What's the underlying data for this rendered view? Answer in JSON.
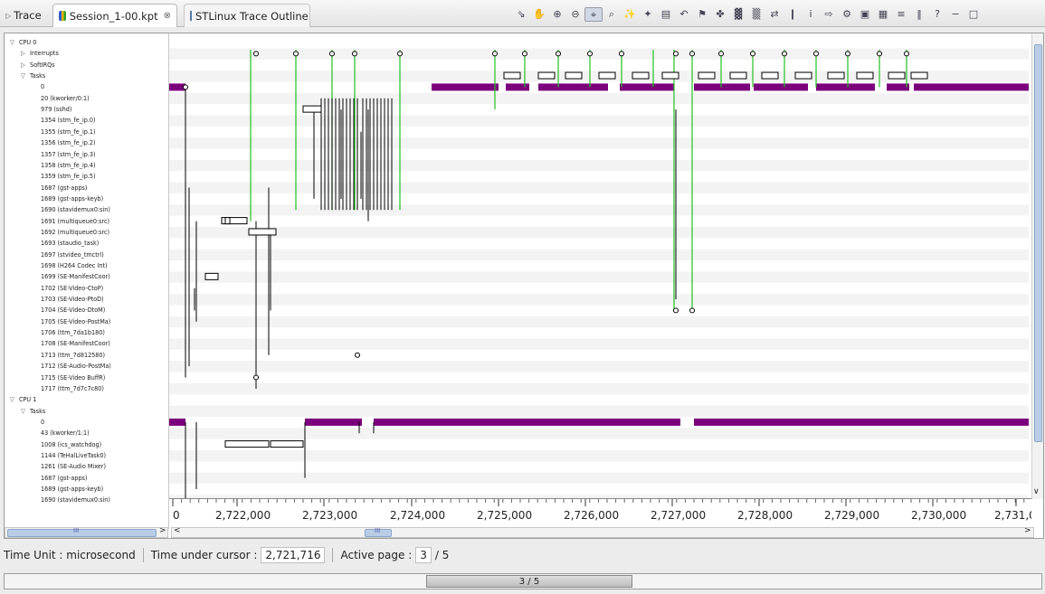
{
  "tabs": [
    {
      "label": "Trace",
      "icon": "chevron-right-icon"
    },
    {
      "label": "Session_1-00.kpt",
      "icon": "trace-file-icon",
      "close": "⊗"
    },
    {
      "label": "STLinux Trace Outline",
      "icon": "outline-icon"
    }
  ],
  "toolbar": [
    {
      "name": "select-tool-icon",
      "glyph": "⇘"
    },
    {
      "name": "hand-tool-icon",
      "glyph": "✋"
    },
    {
      "name": "zoom-in-icon",
      "glyph": "⊕"
    },
    {
      "name": "zoom-out-icon",
      "glyph": "⊖"
    },
    {
      "name": "zoom-area-icon",
      "glyph": "⌖",
      "pressed": true
    },
    {
      "name": "zoom-fit-icon",
      "glyph": "⌕"
    },
    {
      "name": "wand-icon",
      "glyph": "✨"
    },
    {
      "name": "filter-icon",
      "glyph": "✦"
    },
    {
      "name": "grid-icon",
      "glyph": "▤"
    },
    {
      "name": "undo-icon",
      "glyph": "↶"
    },
    {
      "name": "marker-icon",
      "glyph": "⚑"
    },
    {
      "name": "chart-icon",
      "glyph": "✤"
    },
    {
      "name": "histogram-icon",
      "glyph": "▓"
    },
    {
      "name": "histogram-green-icon",
      "glyph": "▒"
    },
    {
      "name": "sync-icon",
      "glyph": "⇄"
    },
    {
      "name": "bar-icon",
      "glyph": "❙"
    },
    {
      "name": "info-icon",
      "glyph": "i"
    },
    {
      "name": "export-icon",
      "glyph": "⇨"
    },
    {
      "name": "settings-icon",
      "glyph": "⚙"
    },
    {
      "name": "panel-icon",
      "glyph": "▣"
    },
    {
      "name": "layout-icon",
      "glyph": "▦"
    },
    {
      "name": "tree-icon",
      "glyph": "≡"
    },
    {
      "name": "pause-icon",
      "glyph": "‖"
    },
    {
      "name": "help-icon",
      "glyph": "?"
    },
    {
      "name": "minimize-icon",
      "glyph": "−"
    },
    {
      "name": "maximize-icon",
      "glyph": "□"
    }
  ],
  "tree_rows": [
    {
      "label": "CPU 0",
      "indent": 0,
      "twisty": "▽"
    },
    {
      "label": "Interrupts",
      "indent": 1,
      "twisty": "▷"
    },
    {
      "label": "SoftIRQs",
      "indent": 1,
      "twisty": "▷"
    },
    {
      "label": "Tasks",
      "indent": 1,
      "twisty": "▽"
    },
    {
      "label": "0",
      "indent": 2
    },
    {
      "label": "20 (kworker/0:1)",
      "indent": 2
    },
    {
      "label": "979 (sshd)",
      "indent": 2
    },
    {
      "label": "1354 (stm_fe_ip.0)",
      "indent": 2
    },
    {
      "label": "1355 (stm_fe_ip.1)",
      "indent": 2
    },
    {
      "label": "1356 (stm_fe_ip.2)",
      "indent": 2
    },
    {
      "label": "1357 (stm_fe_ip.3)",
      "indent": 2
    },
    {
      "label": "1358 (stm_fe_ip.4)",
      "indent": 2
    },
    {
      "label": "1359 (stm_fe_ip.5)",
      "indent": 2
    },
    {
      "label": "1687 (gst-apps)",
      "indent": 2
    },
    {
      "label": "1689 (gst-apps-keyb)",
      "indent": 2
    },
    {
      "label": "1690 (stavidemux0:sin)",
      "indent": 2
    },
    {
      "label": "1691 (multiqueue0:src)",
      "indent": 2
    },
    {
      "label": "1692 (multiqueue0:src)",
      "indent": 2
    },
    {
      "label": "1693 (staudio_task)",
      "indent": 2
    },
    {
      "label": "1697 (stvideo_tmctrl)",
      "indent": 2
    },
    {
      "label": "1698 (H264 Codec Int)",
      "indent": 2
    },
    {
      "label": "1699 (SE-ManifestCoor)",
      "indent": 2
    },
    {
      "label": "1702 (SE-Video-CtoP)",
      "indent": 2
    },
    {
      "label": "1703 (SE-Video-PtoD)",
      "indent": 2
    },
    {
      "label": "1704 (SE-Video-DtoM)",
      "indent": 2
    },
    {
      "label": "1705 (SE-Video-PostMa)",
      "indent": 2
    },
    {
      "label": "1706 (ttm_7da1b180)",
      "indent": 2
    },
    {
      "label": "1708 (SE-ManifestCoor)",
      "indent": 2
    },
    {
      "label": "1713 (ttm_7d812580)",
      "indent": 2
    },
    {
      "label": "1712 (SE-Audio-PostMa)",
      "indent": 2
    },
    {
      "label": "1715 (SE-Video BuffR)",
      "indent": 2
    },
    {
      "label": "1717 (ttm_7d7c7c80)",
      "indent": 2
    },
    {
      "label": "CPU 1",
      "indent": 0,
      "twisty": "▽"
    },
    {
      "label": "Tasks",
      "indent": 1,
      "twisty": "▽"
    },
    {
      "label": "0",
      "indent": 2
    },
    {
      "label": "43 (kworker/1:1)",
      "indent": 2
    },
    {
      "label": "1008 (ics_watchdog)",
      "indent": 2
    },
    {
      "label": "1144 (TeHalLiveTask0)",
      "indent": 2
    },
    {
      "label": "1261 (SE-Audio Mixer)",
      "indent": 2
    },
    {
      "label": "1687 (gst-apps)",
      "indent": 2
    },
    {
      "label": "1689 (gst-apps-keyb)",
      "indent": 2
    },
    {
      "label": "1690 (stavidemux0:sin)",
      "indent": 2
    }
  ],
  "axis": {
    "ticks": [
      "0",
      "2,722,000",
      "2,723,000",
      "2,724,000",
      "2,725,000",
      "2,726,000",
      "2,727,000",
      "2,728,000",
      "2,729,000",
      "2,730,000",
      "2,731,0"
    ]
  },
  "scroll_glyphs": {
    "left": "<",
    "right": ">",
    "down": "∨",
    "grip": "III"
  },
  "status": {
    "time_unit": "Time Unit : microsecond",
    "cursor_label": "Time under cursor :",
    "cursor_value": "2,721,716",
    "page_label": "Active page :",
    "page_value": "3",
    "page_total": "/ 5"
  },
  "pager": {
    "label": "3 / 5"
  },
  "colors": {
    "running": "#7b007b",
    "wakeup": "#22c022",
    "arrow": "#000000",
    "stripe": "#f3f3f3"
  }
}
